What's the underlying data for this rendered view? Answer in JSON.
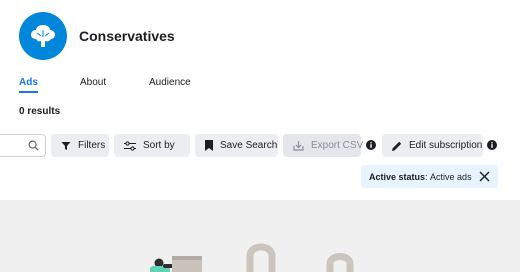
{
  "page": {
    "name": "Conservatives",
    "brand_color": "#0087dc",
    "logo_icon": "tree-icon"
  },
  "tabs": [
    {
      "label": "Ads",
      "active": true
    },
    {
      "label": "About",
      "active": false
    },
    {
      "label": "Audience",
      "active": false
    }
  ],
  "results": {
    "count_text": "0 results"
  },
  "toolbar": {
    "search_icon": "search-icon",
    "filters_label": "Filters",
    "sort_label": "Sort by",
    "save_search_label": "Save Search",
    "export_csv_label": "Export CSV",
    "export_csv_disabled": true,
    "edit_subscription_label": "Edit subscription"
  },
  "status_chip": {
    "key": "Active status",
    "value": "Active ads"
  },
  "colors": {
    "accent": "#1877f2",
    "chip_bg": "#e7f3ff",
    "button_bg": "#ebedf0",
    "empty_bg": "#f0f0f0"
  }
}
